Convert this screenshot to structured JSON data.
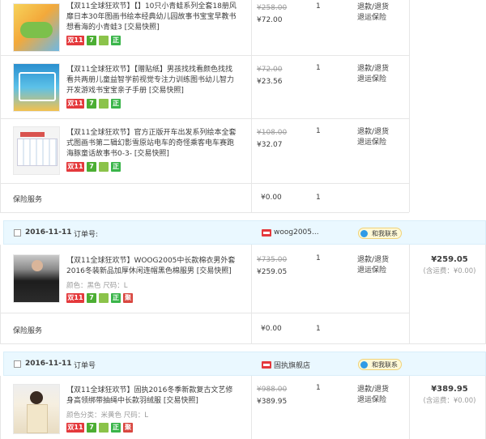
{
  "section1": {
    "items": [
      {
        "title": "【双11全球狂欢节】【】10只小青蛙系列全套18册风靡日本30年图画书绘本经典幼儿园故事书宝宝早教书想看海的小青蛙3",
        "snapshot": "[交易快照]",
        "orig_price": "¥258.00",
        "price": "¥72.00",
        "qty": "1",
        "service1": "退款/退货",
        "service2": "退运保险"
      },
      {
        "title": "【双11全球狂欢节】【赠贴纸】男孩找找看颜色找找看共两册儿童益智学前视觉专注力训练图书幼儿智力开发游戏书宝宝亲子手册",
        "snapshot": "[交易快照]",
        "orig_price": "¥72.00",
        "price": "¥23.56",
        "qty": "1",
        "service1": "退款/退货",
        "service2": "退运保险"
      },
      {
        "title": "【双11全球狂欢节】官方正版开车出发系列绘本全套式图画书第二辑幻影雪原站电车的奇怪乘客电车赛跑海豚童话故事书0-3-",
        "snapshot": "[交易快照]",
        "orig_price": "¥108.00",
        "price": "¥32.07",
        "qty": "1",
        "service1": "退款/退货",
        "service2": "退运保险"
      }
    ],
    "insurance": {
      "label": "保险服务",
      "price": "¥0.00",
      "qty": "1"
    }
  },
  "order2": {
    "date": "2016-11-11",
    "order_no_label": "订单号:",
    "shop": "woog2005...",
    "contact": "和我联系",
    "item": {
      "title": "【双11全球狂欢节】WOOG2005中长款棉衣男外套 2016冬装新品加厚休闲连帽黑色棉服男",
      "snapshot": "[交易快照]",
      "props": "颜色：黑色  尺码：L",
      "orig_price": "¥735.00",
      "price": "¥259.05",
      "qty": "1",
      "service1": "退款/退货",
      "service2": "退运保险"
    },
    "total": "¥259.05",
    "shipping": "(含运费：¥0.00)",
    "insurance": {
      "label": "保险服务",
      "price": "¥0.00",
      "qty": "1"
    }
  },
  "order3": {
    "date": "2016-11-11",
    "order_no_label": "订单号",
    "shop": "固执旗舰店",
    "contact": "和我联系",
    "item": {
      "title": "【双11全球狂欢节】固执2016冬季新款复古文艺修身高领绑带抽绳中长款羽绒服",
      "snapshot": "[交易快照]",
      "props": "颜色分类：米黄色  尺码：L",
      "orig_price": "¥988.00",
      "price": "¥389.95",
      "qty": "1",
      "service1": "退款/退货",
      "service2": "退运保险"
    },
    "total": "¥389.95",
    "shipping": "(含运费：¥0.00)"
  },
  "badges": {
    "b11": "双11",
    "b7": "7",
    "bg": "",
    "bz": "正",
    "bred": "聚"
  },
  "colors": {
    "accent_red": "#e4393c",
    "header_bg": "#eaf8ff",
    "badge_green": "#4cae33"
  }
}
